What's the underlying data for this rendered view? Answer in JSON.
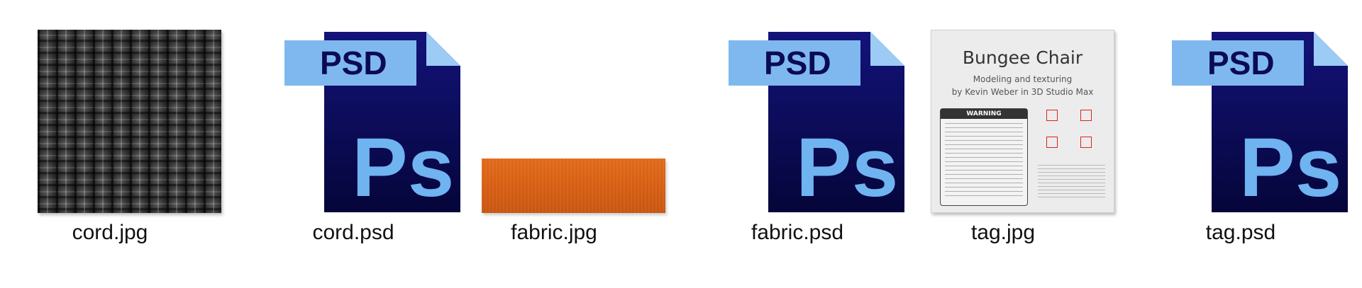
{
  "files": [
    {
      "name": "cord.jpg",
      "kind": "jpg-texture",
      "thumbnail": "cord-weave-thumbnail"
    },
    {
      "name": "cord.psd",
      "kind": "psd",
      "thumbnail": "photoshop-file-icon"
    },
    {
      "name": "fabric.jpg",
      "kind": "jpg-texture",
      "thumbnail": "orange-fabric-thumbnail"
    },
    {
      "name": "fabric.psd",
      "kind": "psd",
      "thumbnail": "photoshop-file-icon"
    },
    {
      "name": "tag.jpg",
      "kind": "jpg-tag",
      "thumbnail": "tag-thumbnail"
    },
    {
      "name": "tag.psd",
      "kind": "psd",
      "thumbnail": "photoshop-file-icon"
    }
  ],
  "psd_icon": {
    "tab_text": "PSD",
    "logo_text": "Ps",
    "colors": {
      "body": "#0b0b55",
      "tab": "#7fb8ef",
      "tab_text": "#0b0b55",
      "logo": "#6fb3f0",
      "fold": "#9ccbf6"
    }
  },
  "tag_thumb": {
    "title": "Bungee Chair",
    "line1": "Modeling and texturing",
    "line2": "by Kevin Weber in 3D Studio Max",
    "warning": "WARNING"
  },
  "colors": {
    "fabric": "#d85f12",
    "cord": "#2d2d2d"
  }
}
